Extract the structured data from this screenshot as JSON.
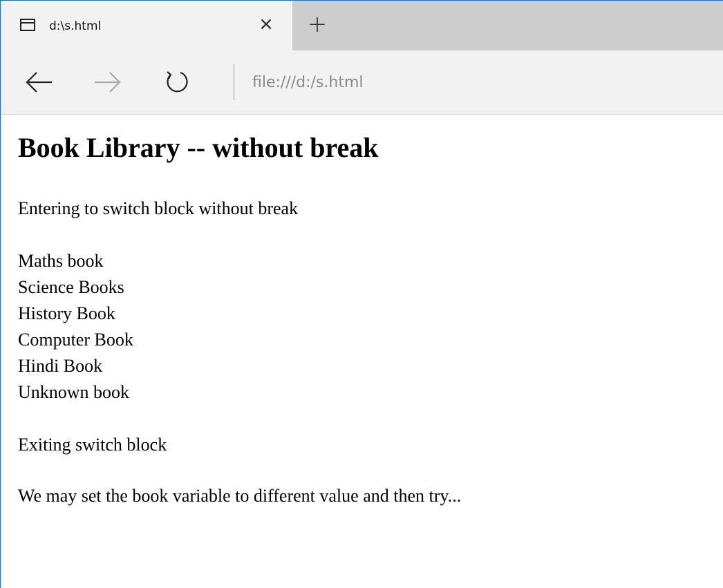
{
  "tab": {
    "title": "d:\\s.html",
    "close_glyph": "×",
    "new_tab_glyph": "+"
  },
  "nav": {
    "address": "file:///d:/s.html"
  },
  "page": {
    "heading": "Book Library -- without break",
    "entering": "Entering to switch block without break",
    "books": [
      "Maths book",
      "Science Books",
      "History Book",
      "Computer Book",
      "Hindi Book",
      "Unknown book"
    ],
    "exiting": "Exiting switch block",
    "note": "We may set the book variable to different value and then try..."
  },
  "icons": {
    "tab_icon": "tab-page-icon",
    "close": "close-icon",
    "new_tab": "plus-icon",
    "back": "arrow-left-icon",
    "forward": "arrow-right-icon",
    "refresh": "refresh-icon"
  },
  "colors": {
    "window_border": "#2b6cb5",
    "tabstrip_bg": "#cccccc",
    "chrome_bg": "#f2f2f2",
    "address_text": "#8a8a8a"
  }
}
